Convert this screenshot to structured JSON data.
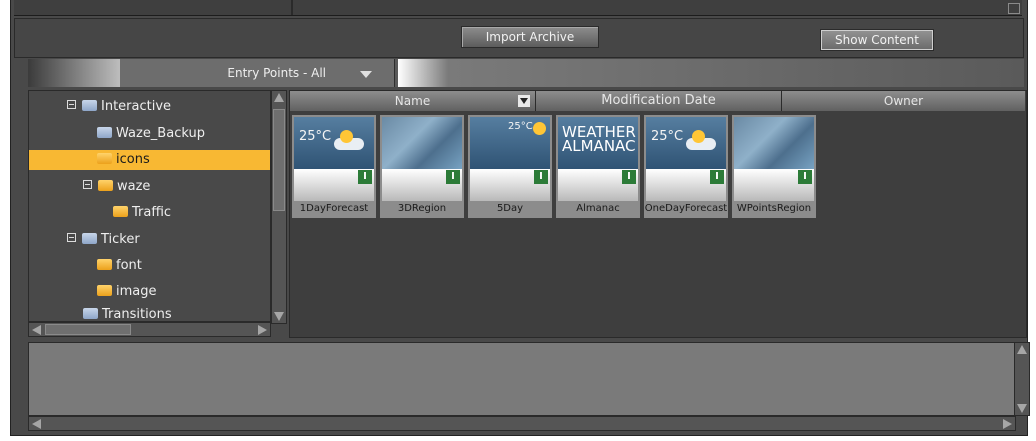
{
  "toolbar": {
    "import_label": "Import Archive",
    "show_content_label": "Show Content"
  },
  "filter": {
    "entry_points_label": "Entry Points - All"
  },
  "tree": {
    "items": [
      {
        "label": "Interactive",
        "color": "blue",
        "expander": true
      },
      {
        "label": "Waze_Backup",
        "color": "blue",
        "expander": false
      },
      {
        "label": "icons",
        "color": "yellow",
        "expander": false,
        "selected": true
      },
      {
        "label": "waze",
        "color": "yellow",
        "expander": true
      },
      {
        "label": "Traffic",
        "color": "yellow",
        "expander": false
      },
      {
        "label": "Ticker",
        "color": "blue",
        "expander": true
      },
      {
        "label": "font",
        "color": "yellow",
        "expander": false
      },
      {
        "label": "image",
        "color": "yellow",
        "expander": false
      },
      {
        "label": "Transitions",
        "color": "blue",
        "expander": false
      }
    ]
  },
  "columns": {
    "name": "Name",
    "modification_date": "Modification Date",
    "owner": "Owner"
  },
  "thumbnails": [
    {
      "label": "1DayForecast",
      "preview_text": "25°C",
      "kind": "forecast"
    },
    {
      "label": "3DRegion",
      "preview_text": "",
      "kind": "map"
    },
    {
      "label": "5Day",
      "preview_text": "25°C",
      "kind": "5day"
    },
    {
      "label": "Almanac",
      "preview_text": "WEATHER ALMANAC",
      "kind": "almanac"
    },
    {
      "label": "OneDayForecast",
      "preview_text": "25°C",
      "kind": "forecast"
    },
    {
      "label": "WPointsRegion",
      "preview_text": "",
      "kind": "map"
    }
  ],
  "colors": {
    "selection": "#f8b833",
    "panel": "#494949",
    "badge": "#2c7b38"
  }
}
